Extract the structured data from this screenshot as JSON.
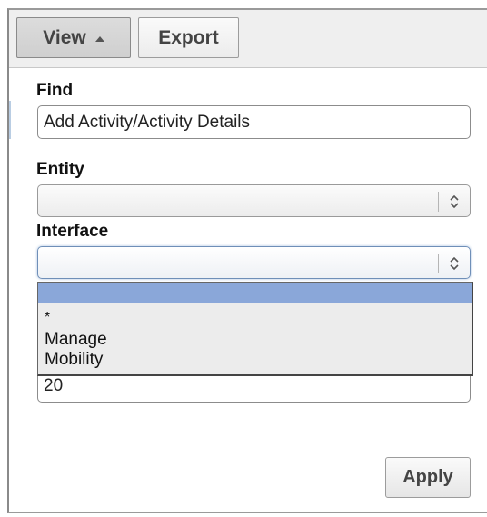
{
  "toolbar": {
    "view_label": "View",
    "export_label": "Export"
  },
  "form": {
    "find": {
      "label": "Find",
      "value": "Add Activity/Activity Details"
    },
    "entity": {
      "label": "Entity",
      "value": ""
    },
    "interface": {
      "label": "Interface",
      "value": "",
      "options": [
        "",
        "*",
        "Manage",
        "Mobility"
      ]
    },
    "hidden_field": {
      "value": "20"
    },
    "apply_label": "Apply"
  },
  "colors": {
    "selected_option": "#8aa7d9",
    "toolbar_bg": "#efefef",
    "active_tab": "#d2d2d2"
  }
}
